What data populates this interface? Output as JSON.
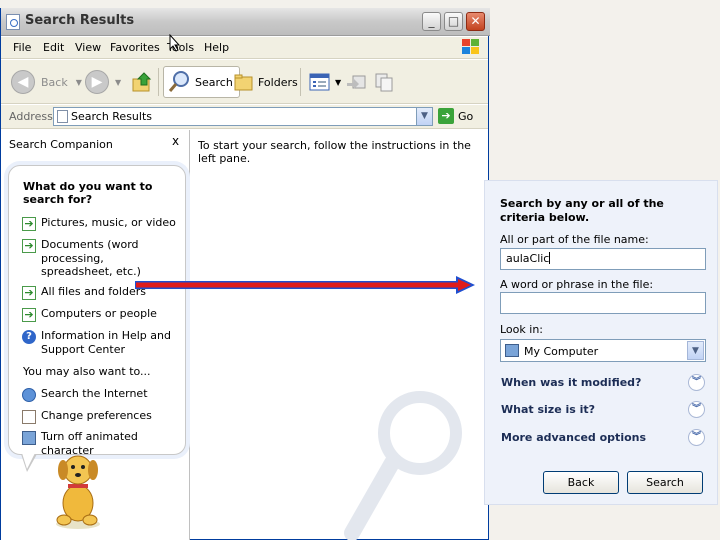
{
  "window": {
    "title": "Search Results",
    "buttons": {
      "minimize": "_",
      "maximize": "□",
      "close": "✕"
    }
  },
  "menu": [
    "File",
    "Edit",
    "View",
    "Favorites",
    "Tools",
    "Help"
  ],
  "toolbar": {
    "back": "Back",
    "search": "Search",
    "folders": "Folders"
  },
  "address": {
    "label": "Address",
    "value": "Search Results",
    "go": "Go"
  },
  "companion": {
    "title": "Search Companion",
    "close": "x",
    "question": "What do you want to search for?",
    "options": [
      {
        "label": "Pictures, music, or video",
        "icon": "arrow-right-icon"
      },
      {
        "label": "Documents (word processing, spreadsheet, etc.)",
        "icon": "arrow-right-icon"
      },
      {
        "label": "All files and folders",
        "icon": "arrow-right-icon"
      },
      {
        "label": "Computers or people",
        "icon": "arrow-right-icon"
      },
      {
        "label": "Information in Help and Support Center",
        "icon": "help-icon"
      }
    ],
    "also_label": "You may also want to...",
    "also": [
      {
        "label": "Search the Internet",
        "icon": "globe-search-icon"
      },
      {
        "label": "Change preferences",
        "icon": "preferences-icon"
      },
      {
        "label": "Turn off animated character",
        "icon": "computer-icon"
      }
    ]
  },
  "instructions": "To start your search, follow the instructions in the left pane.",
  "panel": {
    "heading": "Search by any or all of the criteria below.",
    "filename_label": "All or part of the file name:",
    "filename_value": "aulaClic",
    "phrase_label": "A word or phrase in the file:",
    "phrase_value": "",
    "lookin_label": "Look in:",
    "lookin_value": "My Computer",
    "modified": "When was it modified?",
    "size": "What size is it?",
    "advanced": "More advanced options",
    "back_button": "Back",
    "search_button": "Search"
  },
  "colors": {
    "arrow_red": "#e01c1c",
    "arrow_blue": "#1f4fd0",
    "xp_blue": "#003c9e"
  }
}
